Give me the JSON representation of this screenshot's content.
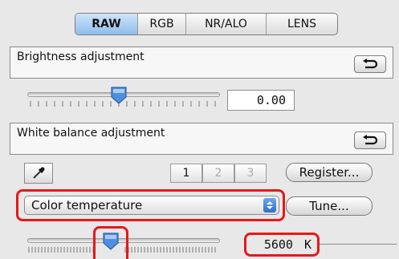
{
  "tabs": [
    {
      "label": "RAW",
      "active": true
    },
    {
      "label": "RGB",
      "active": false
    },
    {
      "label": "NR/ALO",
      "active": false
    },
    {
      "label": "LENS",
      "active": false
    }
  ],
  "brightness": {
    "title": "Brightness adjustment",
    "value": "0.00",
    "slider_level": 0.5
  },
  "white_balance": {
    "title": "White balance adjustment",
    "presets": [
      "1",
      "2",
      "3"
    ],
    "active_preset": "1",
    "register_label": "Register...",
    "tune_label": "Tune...",
    "mode": "Color temperature",
    "temperature_value": "5600",
    "temperature_unit": "K"
  },
  "icons": {
    "reset": "reset-arrow-icon",
    "eyedropper": "eyedropper-icon",
    "dropdown": "chevron-updown-icon"
  },
  "colors": {
    "highlight": "#e8171b",
    "active_tab": "#9cc6ee",
    "thumb": "#4f8fe0"
  }
}
